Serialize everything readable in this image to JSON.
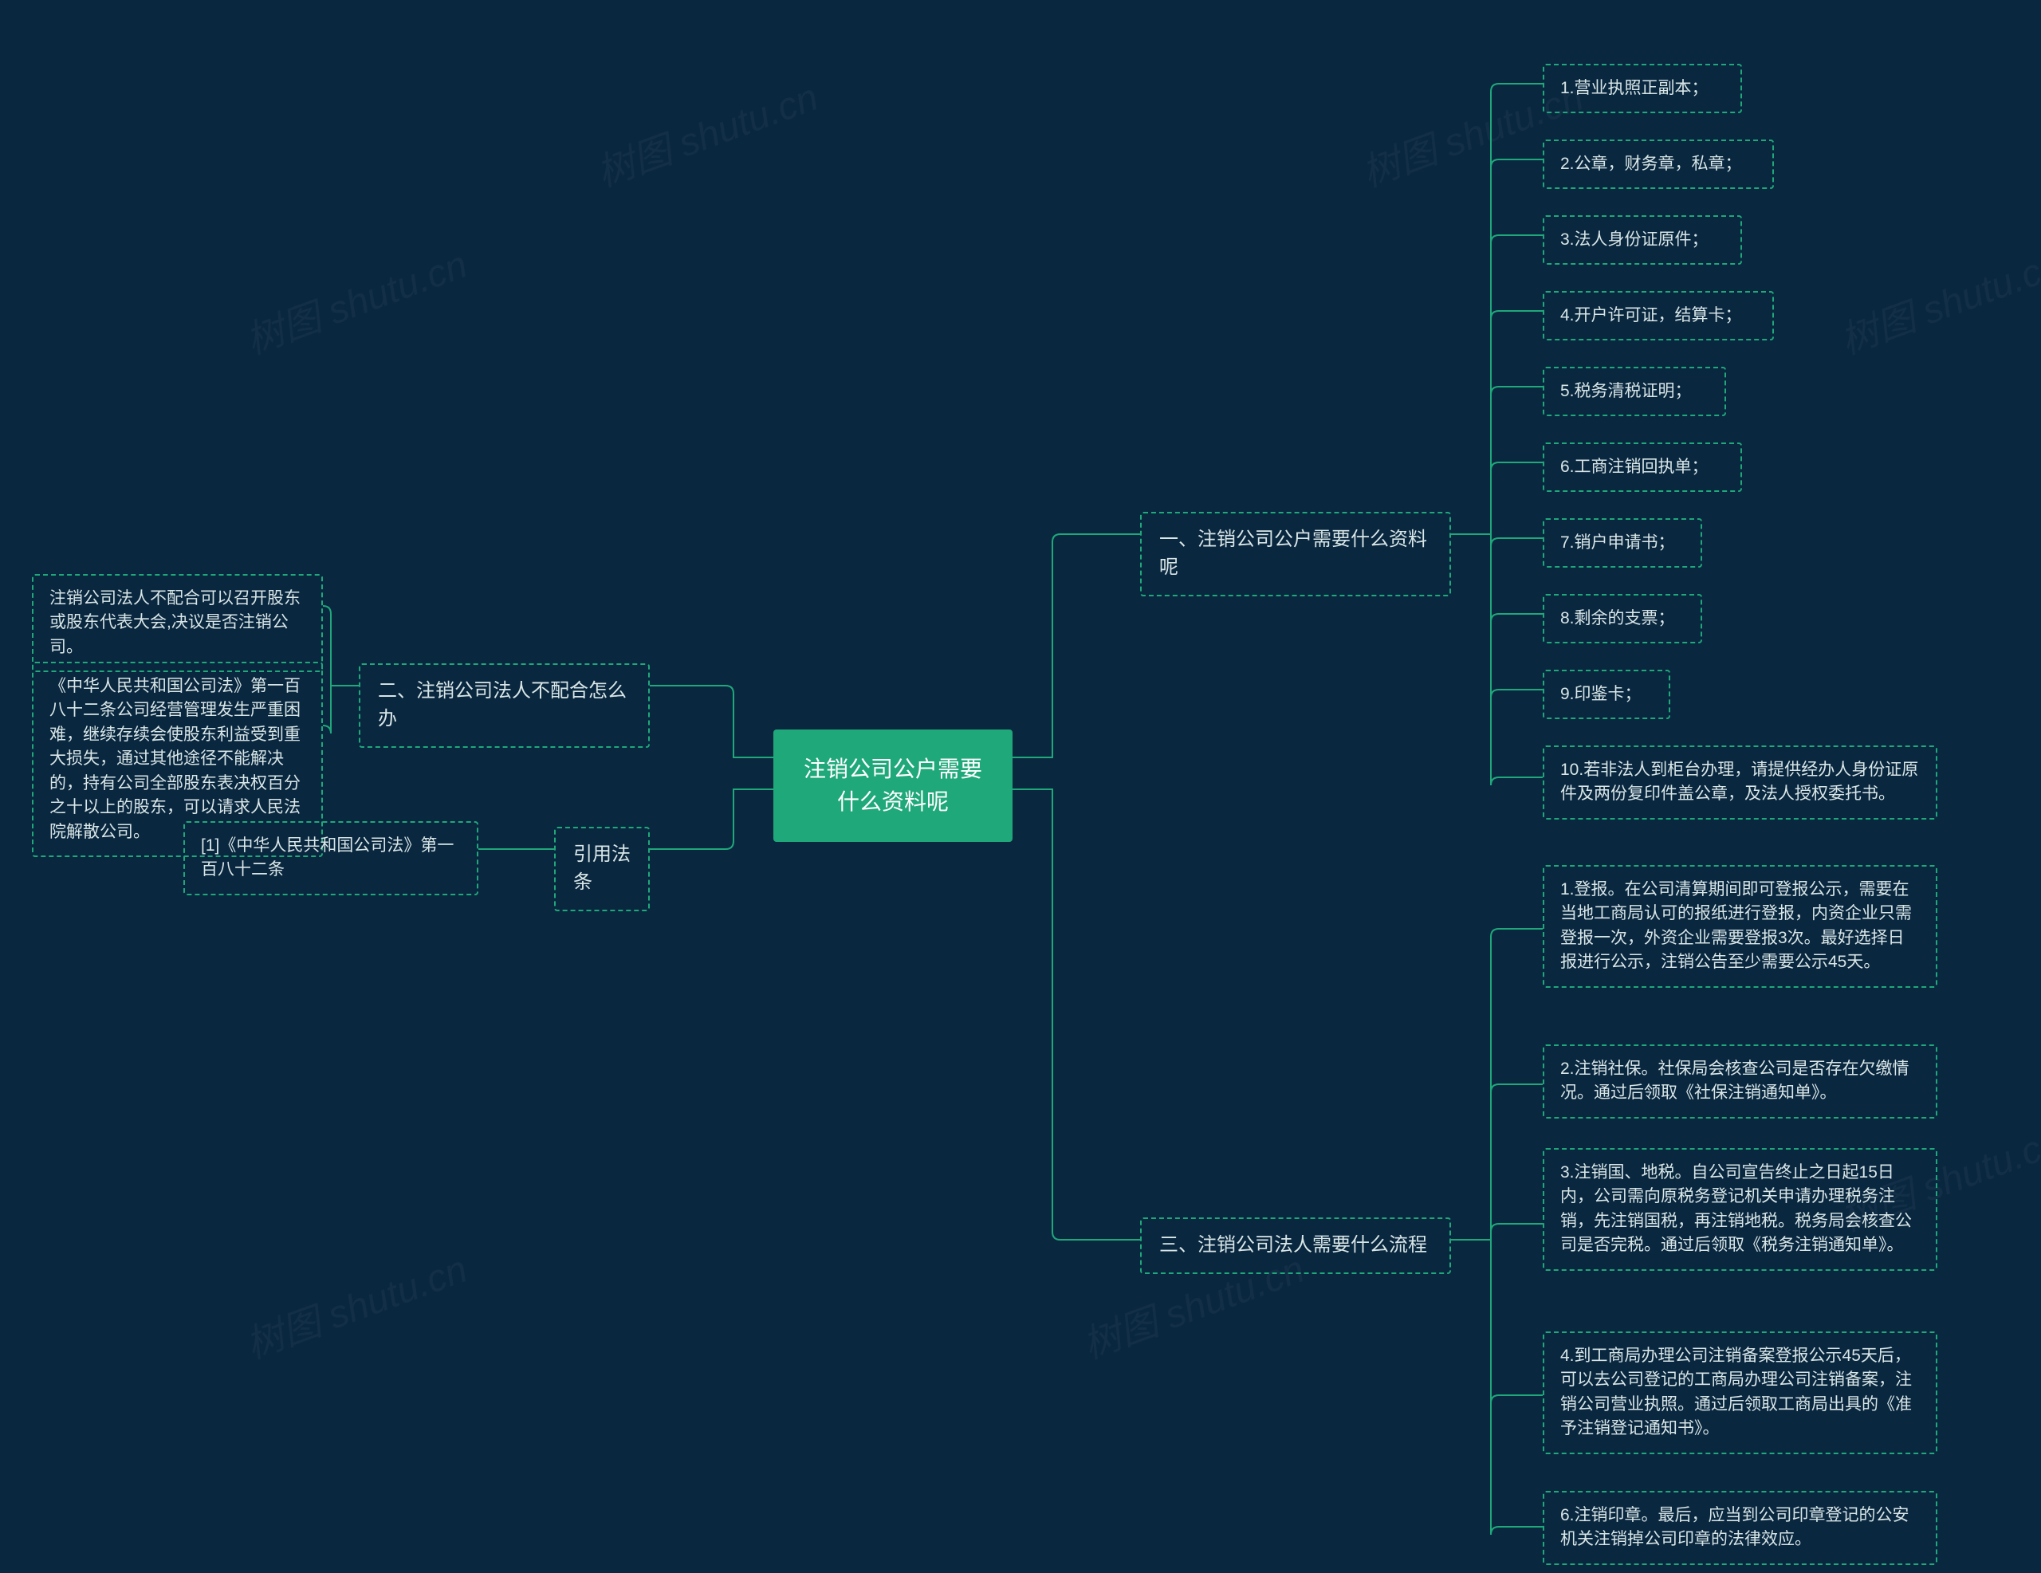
{
  "root": {
    "title": "注销公司公户需要什么资料呢"
  },
  "branches": {
    "b1": {
      "label": "一、注销公司公户需要什么资料呢"
    },
    "b2": {
      "label": "二、注销公司法人不配合怎么办"
    },
    "b3": {
      "label": "三、注销公司法人需要什么流程"
    },
    "b4": {
      "label": "引用法条"
    }
  },
  "b1_items": {
    "i1": "1.营业执照正副本；",
    "i2": "2.公章，财务章，私章；",
    "i3": "3.法人身份证原件；",
    "i4": "4.开户许可证，结算卡；",
    "i5": "5.税务清税证明；",
    "i6": "6.工商注销回执单；",
    "i7": "7.销户申请书；",
    "i8": "8.剩余的支票；",
    "i9": "9.印鉴卡；",
    "i10": "10.若非法人到柜台办理，请提供经办人身份证原件及两份复印件盖公章，及法人授权委托书。"
  },
  "b2_items": {
    "i1": "注销公司法人不配合可以召开股东或股东代表大会,决议是否注销公司。",
    "i2": "《中华人民共和国公司法》第一百八十二条公司经营管理发生严重困难，继续存续会使股东利益受到重大损失，通过其他途径不能解决的，持有公司全部股东表决权百分之十以上的股东，可以请求人民法院解散公司。"
  },
  "b3_items": {
    "i1": "1.登报。在公司清算期间即可登报公示，需要在当地工商局认可的报纸进行登报，内资企业只需登报一次，外资企业需要登报3次。最好选择日报进行公示，注销公告至少需要公示45天。",
    "i2": "2.注销社保。社保局会核查公司是否存在欠缴情况。通过后领取《社保注销通知单》。",
    "i3": "3.注销国、地税。自公司宣告终止之日起15日内，公司需向原税务登记机关申请办理税务注销，先注销国税，再注销地税。税务局会核查公司是否完税。通过后领取《税务注销通知单》。",
    "i4": "4.到工商局办理公司注销备案登报公示45天后，可以去公司登记的工商局办理公司注销备案，注销公司营业执照。通过后领取工商局出具的《准予注销登记通知书》。",
    "i5": "6.注销印章。最后，应当到公司印章登记的公安机关注销掉公司印章的法律效应。"
  },
  "b4_items": {
    "i1": "[1]《中华人民共和国公司法》第一百八十二条"
  },
  "watermark": "树图 shutu.cn"
}
